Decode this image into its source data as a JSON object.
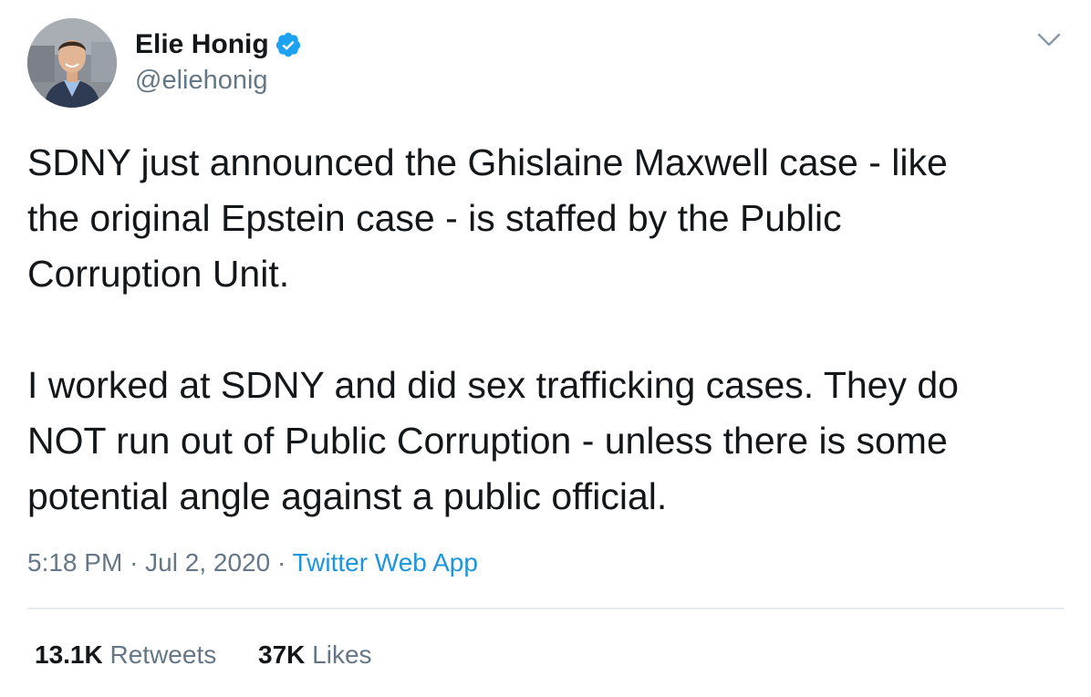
{
  "author": {
    "display_name": "Elie Honig",
    "handle": "@eliehonig",
    "verified": true,
    "avatar_icon": "profile-photo"
  },
  "tweet": {
    "paragraphs": [
      [
        "SDNY just announced the Ghislaine Maxwell case - like",
        "the original Epstein case - is staffed by the Public",
        "Corruption Unit."
      ],
      [
        "I worked at SDNY and did sex trafficking cases. They do",
        "NOT run out of Public Corruption - unless there is some",
        "potential angle against a public official."
      ]
    ]
  },
  "meta": {
    "time": "5:18 PM",
    "separator": "·",
    "date": "Jul 2, 2020",
    "source": "Twitter Web App"
  },
  "stats": {
    "retweets_count": "13.1K",
    "retweets_label": "Retweets",
    "likes_count": "37K",
    "likes_label": "Likes"
  },
  "colors": {
    "text_primary": "#14171a",
    "text_secondary": "#657786",
    "link": "#1b95e0",
    "verified_badge": "#1da1f2",
    "divider": "#e6ecf0"
  },
  "icons": {
    "verified": "verified-badge-icon",
    "menu": "chevron-down-icon"
  }
}
